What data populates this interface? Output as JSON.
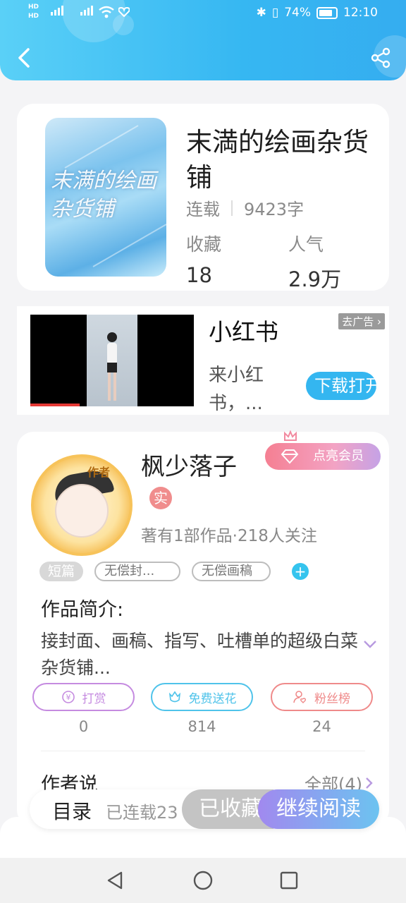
{
  "status_bar": {
    "left_indicators": "HD 4G 4G",
    "battery": "74%",
    "time": "12:10"
  },
  "header": {
    "icons": [
      "back-arrow-icon",
      "share-icon"
    ],
    "colors": {
      "gradient_start": "#5ad0f7",
      "gradient_end": "#35adf0"
    }
  },
  "book": {
    "cover_title_art": "末满的绘画 杂货铺",
    "title": "末満的绘画杂货铺",
    "status": "连载",
    "word_count": "9423字",
    "favorites_label": "收藏",
    "favorites_value": "18",
    "popularity_label": "人气",
    "popularity_value": "2.9万"
  },
  "ad": {
    "title": "小红书",
    "description": "来小红书，...",
    "close_label": "去广告",
    "cta_label": "下载打开"
  },
  "author": {
    "name": "枫少落子",
    "avatar_tag": "作者",
    "verified_badge": "实",
    "stats": "著有1部作品·218人关注",
    "vip_button": "点亮会员",
    "tags": [
      "短篇",
      "无偿封...",
      "无偿画稿"
    ],
    "intro_heading": "作品简介:",
    "intro_text": "接封面、画稿、指写、吐槽单的超级白菜杂货铺...",
    "actions": [
      {
        "label": "打赏",
        "count": "0",
        "color": "#c58be0"
      },
      {
        "label": "免费送花",
        "count": "814",
        "color": "#4fc3ea"
      },
      {
        "label": "粉丝榜",
        "count": "24",
        "color": "#ef8a8a"
      }
    ],
    "say_heading": "作者说",
    "say_all": "全部(4)"
  },
  "bottom_bar": {
    "toc": "目录",
    "serial": "已连载23",
    "collected": "已收藏",
    "continue": "继续阅读"
  },
  "navbar": {
    "icons": [
      "back-triangle-icon",
      "home-circle-icon",
      "recents-square-icon"
    ]
  }
}
